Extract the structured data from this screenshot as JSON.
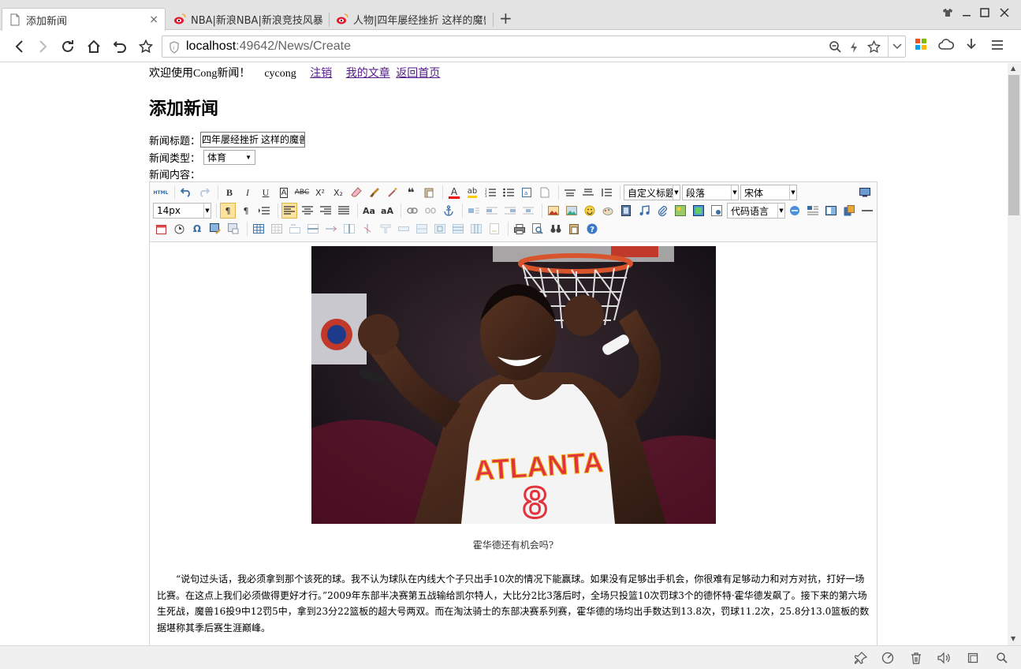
{
  "browser": {
    "tabs": [
      {
        "title": "添加新闻",
        "active": true
      },
      {
        "title": "NBA|新浪NBA|新浪竞技风暴",
        "active": false
      },
      {
        "title": "人物|四年屡经挫折 这样的魔兽",
        "active": false
      }
    ],
    "url_host": "localhost",
    "url_path": ":49642/News/Create",
    "close_glyph": "×",
    "newtab_glyph": "+"
  },
  "page": {
    "welcome": "欢迎使用Cong新闻！",
    "username": "cycong",
    "links": {
      "logout": "注销",
      "my_articles": "我的文章",
      "home": "返回首页"
    },
    "heading": "添加新闻",
    "form": {
      "title_label": "新闻标题：",
      "title_value": "四年屡经挫折 这样的魔兽",
      "type_label": "新闻类型：",
      "type_value": "体育",
      "content_label": "新闻内容："
    }
  },
  "editor": {
    "row1_html": "HTML",
    "custom_title": "自定义标题",
    "paragraph": "段落",
    "font": "宋体",
    "font_size": "14px",
    "code_lang": "代码语言",
    "content": {
      "image_alt_jersey": "ATLANTA",
      "jersey_number": "8",
      "caption": "霍华德还有机会吗?",
      "paragraph": "“说句过头话，我必须拿到那个该死的球。我不认为球队在内线大个子只出手10次的情况下能赢球。如果没有足够出手机会，你很难有足够动力和对方对抗，打好一场比赛。在这点上我们必须做得更好才行。”2009年东部半决赛第五战输给凯尔特人，大比分2比3落后时，全场只投篮10次罚球3个的德怀特·霍华德发飙了。接下来的第六场生死战，魔兽16投9中12罚5中，拿到23分22篮板的超大号两双。而在淘汰骑士的东部决赛系列赛，霍华德的场均出手数达到13.8次，罚球11.2次，25.8分13.0篮板的数据堪称其季后赛生涯巅峰。"
    }
  },
  "colors": {
    "link": "#551a8b",
    "weibo_red": "#e6162d",
    "active_tool": "#fde3a0"
  }
}
